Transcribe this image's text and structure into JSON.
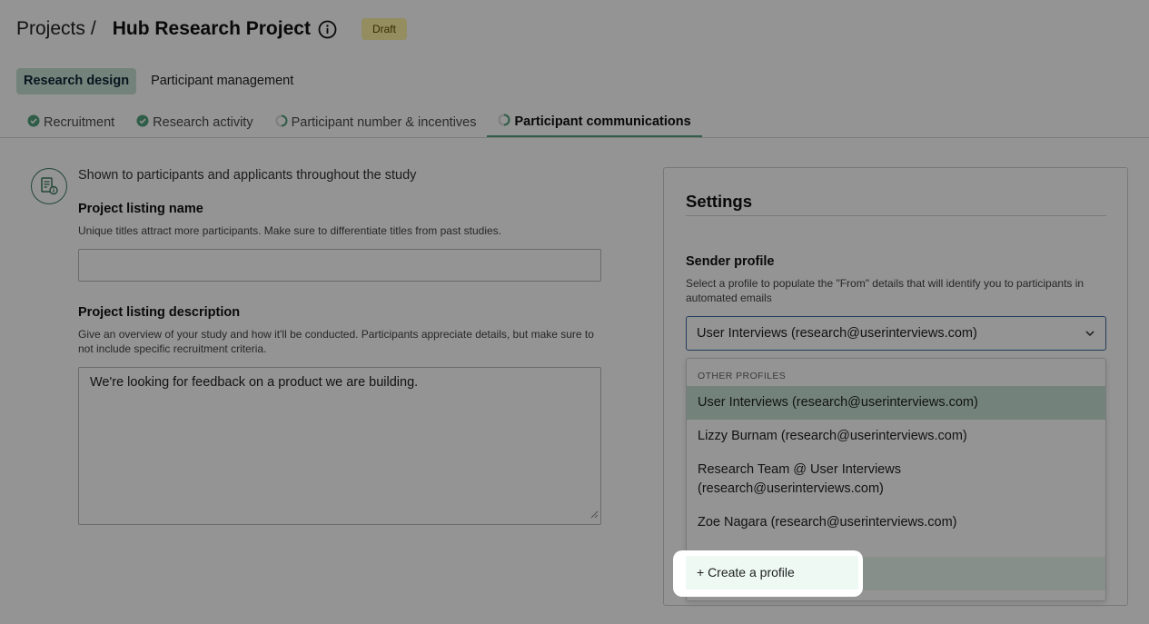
{
  "header": {
    "breadcrumb_root": "Projects",
    "breadcrumb_sep": "/",
    "title": "Hub Research Project",
    "status_badge": "Draft"
  },
  "primary_tabs": [
    {
      "label": "Research design",
      "active": true
    },
    {
      "label": "Participant management",
      "active": false
    }
  ],
  "steps": [
    {
      "label": "Recruitment",
      "status": "complete",
      "icon": "check-circle-icon"
    },
    {
      "label": "Research activity",
      "status": "complete",
      "icon": "check-circle-icon"
    },
    {
      "label": "Participant number & incentives",
      "status": "in-progress",
      "icon": "progress-ring-icon"
    },
    {
      "label": "Participant communications",
      "status": "active",
      "icon": "progress-ring-icon"
    }
  ],
  "left": {
    "intro": "Shown to participants and applicants throughout the study",
    "listing_name_label": "Project listing name",
    "listing_name_help": "Unique titles attract more participants. Make sure to differentiate titles from past studies.",
    "listing_name_value": "",
    "listing_desc_label": "Project listing description",
    "listing_desc_help": "Give an overview of your study and how it'll be conducted. Participants appreciate details, but make sure to not include specific recruitment criteria.",
    "listing_desc_value": "We're looking for feedback on a product we are building."
  },
  "settings": {
    "title": "Settings",
    "sender_label": "Sender profile",
    "sender_help": "Select a profile to populate the \"From\" details that will identify you to participants in automated emails",
    "selected_value": "User Interviews (research@userinterviews.com)",
    "dropdown": {
      "group_label": "OTHER PROFILES",
      "options": [
        "User Interviews (research@userinterviews.com)",
        "Lizzy Burnam (research@userinterviews.com)",
        "Research Team @ User Interviews (research@userinterviews.com)",
        "Zoe Nagara (research@userinterviews.com)"
      ],
      "create_label": "+ Create a profile"
    }
  },
  "colors": {
    "accent_green": "#52a07d",
    "selected_bg": "#c6e2d6",
    "badge_bg": "#fff3a6",
    "focus_blue": "#3b6a9e"
  }
}
